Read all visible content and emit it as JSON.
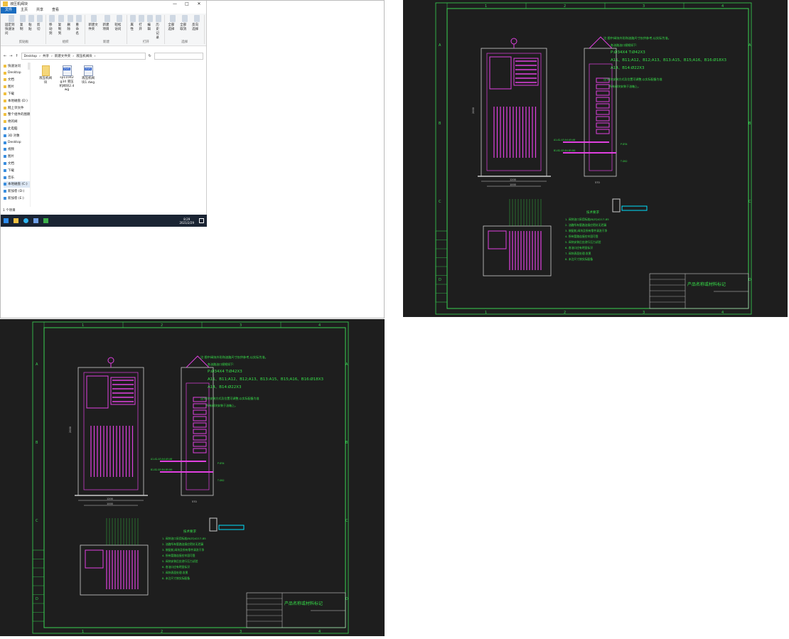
{
  "explorer": {
    "title": "液压机阀块",
    "window_controls": [
      "—",
      "□",
      "✕"
    ],
    "menu": [
      "文件",
      "主页",
      "共享",
      "查看"
    ],
    "ribbon": [
      {
        "label": "剪贴板",
        "buttons": [
          "固定到快速访问",
          "复制",
          "粘贴",
          "剪切"
        ]
      },
      {
        "label": "组织",
        "buttons": [
          "移动到",
          "复制到",
          "删除",
          "重命名"
        ]
      },
      {
        "label": "新建",
        "buttons": [
          "新建文件夹",
          "新建项目",
          "轻松访问"
        ]
      },
      {
        "label": "打开",
        "buttons": [
          "属性",
          "打开",
          "编辑",
          "历史记录"
        ]
      },
      {
        "label": "选择",
        "buttons": [
          "全部选择",
          "全部取消",
          "反向选择"
        ]
      }
    ],
    "breadcrumb": [
      "Desktop",
      "共享",
      "新建文件夹",
      "液压机阀块"
    ],
    "nav_quick": [
      "快速访问",
      "Desktop",
      "文档",
      "图片",
      "下载",
      "本地磁盘 (D:)",
      "网上邻文件",
      "整个组件的图稿",
      "绝的阀"
    ],
    "nav_pc": [
      "此电脑",
      "3D 对象",
      "Desktop",
      "视频",
      "图片",
      "文档",
      "下载",
      "音乐",
      "本地磁盘 (C:)",
      "新加卷 (D:)",
      "新加卷 (E:)"
    ],
    "files": [
      {
        "name": "液压机阀块",
        "type": "folder"
      },
      {
        "name": "sp11042g34 液压机阀块2.dwg",
        "type": "dwg"
      },
      {
        "name": "液压机阀块1.dwg",
        "type": "dwg"
      }
    ],
    "dwg_badge": "DWG",
    "status": "1 个项目",
    "clock_time": "8:29",
    "clock_date": "2021/2/29"
  },
  "drawing": {
    "notes_head": "注:图中阀块外形和油路尺寸仅供参考,以实际为准。",
    "notes_sub": "各油路油口规格如下:",
    "spec1": "P:Ø34X4    T:Ø42X3",
    "spec2": "A11、B11;A12、B12;A13、B13:A15、B15;A16、B16:Ø18X3",
    "spec3": "A14、B14:Ø22X3",
    "note2a": "注:阀块安装方式及位置可调整,以实际配备为准",
    "note2b": "所有阀块安装于油箱上。",
    "tech_title": "技术要求",
    "tech_items": [
      "1. 阀块油口采用标准JB/ZQ4217-85",
      "2. 油路所有管路连接应密封无泄漏",
      "3. 装配前,阀块及所有零件清洗干净",
      "4. 所有管路连接应牢固可靠",
      "5. 阀块安装后应进行压力试验",
      "6. 各油口应有明显标识",
      "7. 阀块表面处理:发黑",
      "8. 未注尺寸按实际配备"
    ],
    "title_block": "产品名称或材料标记",
    "cols": [
      "1",
      "2",
      "3",
      "4"
    ],
    "rows": [
      "A",
      "B",
      "C",
      "D"
    ],
    "dim_labels": [
      "1200",
      "1000",
      "2000",
      "250",
      "570"
    ],
    "port_labels": [
      "A1.A2.A3.A4.A5.A6",
      "B1.B2.B3.B4.B5.B6",
      "P Ø34",
      "T Ø42"
    ],
    "colors": {
      "frame": "#39d353",
      "text": "#37e14a",
      "part": "#e040e0",
      "bg": "#1e1e1e",
      "accent": "#00e0ff"
    }
  }
}
